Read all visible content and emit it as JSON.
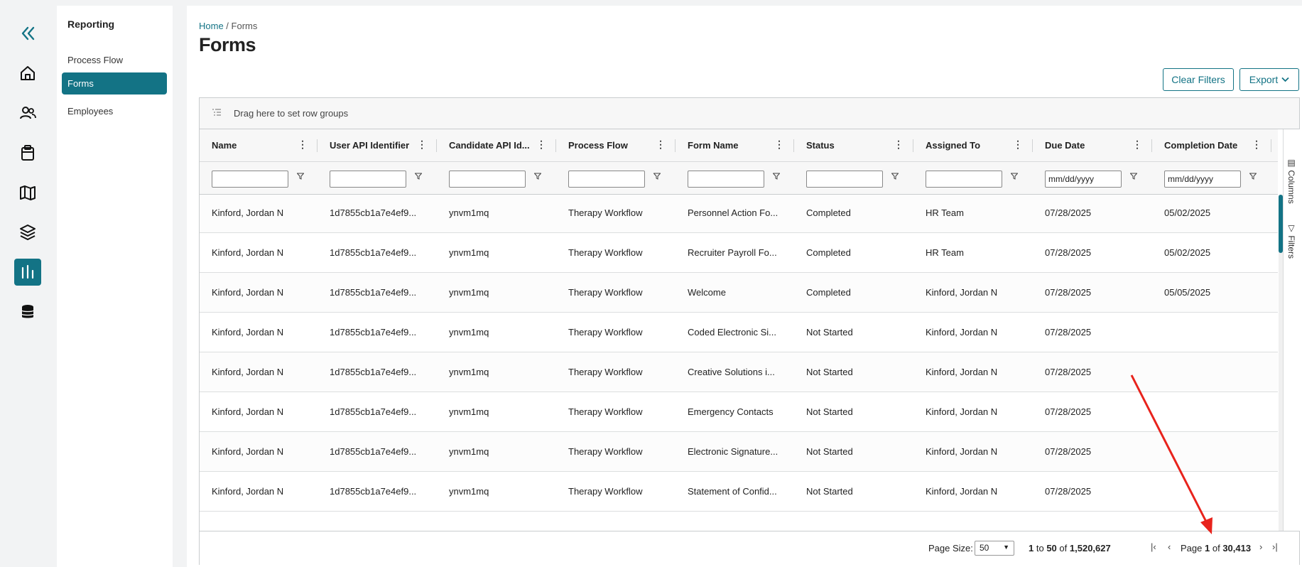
{
  "rail": {
    "items": [
      {
        "name": "collapse-icon"
      },
      {
        "name": "home-icon"
      },
      {
        "name": "people-icon"
      },
      {
        "name": "clipboard-icon"
      },
      {
        "name": "map-icon"
      },
      {
        "name": "layers-icon"
      },
      {
        "name": "reporting-icon",
        "active": true
      },
      {
        "name": "database-icon"
      }
    ]
  },
  "subnav": {
    "title": "Reporting",
    "items": [
      {
        "label": "Process Flow",
        "active": false
      },
      {
        "label": "Forms",
        "active": true
      },
      {
        "label": "Employees",
        "active": false
      }
    ]
  },
  "breadcrumb": {
    "home": "Home",
    "separator": " / ",
    "current": "Forms"
  },
  "page_title": "Forms",
  "toolbar": {
    "clear_filters": "Clear Filters",
    "export": "Export"
  },
  "grid": {
    "group_panel_text": "Drag here to set row groups",
    "columns": [
      {
        "label": "Name",
        "filter": "text"
      },
      {
        "label": "User API Identifier",
        "filter": "text"
      },
      {
        "label": "Candidate API Id...",
        "filter": "text"
      },
      {
        "label": "Process Flow",
        "filter": "text"
      },
      {
        "label": "Form Name",
        "filter": "text"
      },
      {
        "label": "Status",
        "filter": "text"
      },
      {
        "label": "Assigned To",
        "filter": "text"
      },
      {
        "label": "Due Date",
        "filter": "date",
        "placeholder": "mm/dd/yyyy"
      },
      {
        "label": "Completion Date",
        "filter": "date",
        "placeholder": "mm/dd/yyyy"
      }
    ],
    "rows": [
      [
        "Kinford, Jordan N",
        "1d7855cb1a7e4ef9...",
        "ynvm1mq",
        "Therapy Workflow",
        "Personnel Action Fo...",
        "Completed",
        "HR Team",
        "07/28/2025",
        "05/02/2025"
      ],
      [
        "Kinford, Jordan N",
        "1d7855cb1a7e4ef9...",
        "ynvm1mq",
        "Therapy Workflow",
        "Recruiter Payroll Fo...",
        "Completed",
        "HR Team",
        "07/28/2025",
        "05/02/2025"
      ],
      [
        "Kinford, Jordan N",
        "1d7855cb1a7e4ef9...",
        "ynvm1mq",
        "Therapy Workflow",
        "Welcome",
        "Completed",
        "Kinford, Jordan N",
        "07/28/2025",
        "05/05/2025"
      ],
      [
        "Kinford, Jordan N",
        "1d7855cb1a7e4ef9...",
        "ynvm1mq",
        "Therapy Workflow",
        "Coded Electronic Si...",
        "Not Started",
        "Kinford, Jordan N",
        "07/28/2025",
        ""
      ],
      [
        "Kinford, Jordan N",
        "1d7855cb1a7e4ef9...",
        "ynvm1mq",
        "Therapy Workflow",
        "Creative Solutions i...",
        "Not Started",
        "Kinford, Jordan N",
        "07/28/2025",
        ""
      ],
      [
        "Kinford, Jordan N",
        "1d7855cb1a7e4ef9...",
        "ynvm1mq",
        "Therapy Workflow",
        "Emergency Contacts",
        "Not Started",
        "Kinford, Jordan N",
        "07/28/2025",
        ""
      ],
      [
        "Kinford, Jordan N",
        "1d7855cb1a7e4ef9...",
        "ynvm1mq",
        "Therapy Workflow",
        "Electronic Signature...",
        "Not Started",
        "Kinford, Jordan N",
        "07/28/2025",
        ""
      ],
      [
        "Kinford, Jordan N",
        "1d7855cb1a7e4ef9...",
        "ynvm1mq",
        "Therapy Workflow",
        "Statement of Confid...",
        "Not Started",
        "Kinford, Jordan N",
        "07/28/2025",
        ""
      ]
    ],
    "side_tabs": {
      "columns": "Columns",
      "filters": "Filters"
    }
  },
  "footer": {
    "page_size_label": "Page Size:",
    "page_size_value": "50",
    "range_from": "1",
    "range_to_word": "to",
    "range_to": "50",
    "of_word": "of",
    "total_rows": "1,520,627",
    "page_word": "Page",
    "current_page": "1",
    "total_pages": "30,413"
  },
  "colors": {
    "accent": "#137385",
    "annotation_arrow": "#e8231c"
  }
}
